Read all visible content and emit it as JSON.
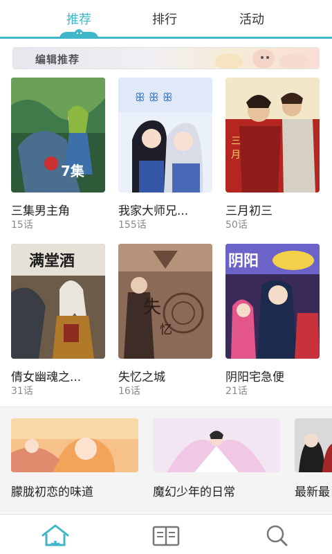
{
  "tabs": [
    {
      "label": "推荐",
      "active": true
    },
    {
      "label": "排行",
      "active": false
    },
    {
      "label": "活动",
      "active": false
    }
  ],
  "accent_color": "#3fb7c9",
  "banner": {
    "title": "编辑推荐"
  },
  "comics": [
    {
      "title": "三集男主角",
      "count": "15话"
    },
    {
      "title": "我家大师兄...",
      "count": "155话"
    },
    {
      "title": "三月初三",
      "count": "50话"
    },
    {
      "title": "倩女幽魂之...",
      "count": "31话"
    },
    {
      "title": "失忆之城",
      "count": "16话"
    },
    {
      "title": "阴阳宅急便",
      "count": "21话"
    }
  ],
  "featured": [
    {
      "title": "朦胧初恋的味道"
    },
    {
      "title": "魔幻少年的日常"
    },
    {
      "title": "最新最"
    }
  ],
  "bottom_nav": [
    {
      "icon": "home-icon",
      "active": true
    },
    {
      "icon": "book-icon",
      "active": false
    },
    {
      "icon": "search-icon",
      "active": false
    }
  ]
}
